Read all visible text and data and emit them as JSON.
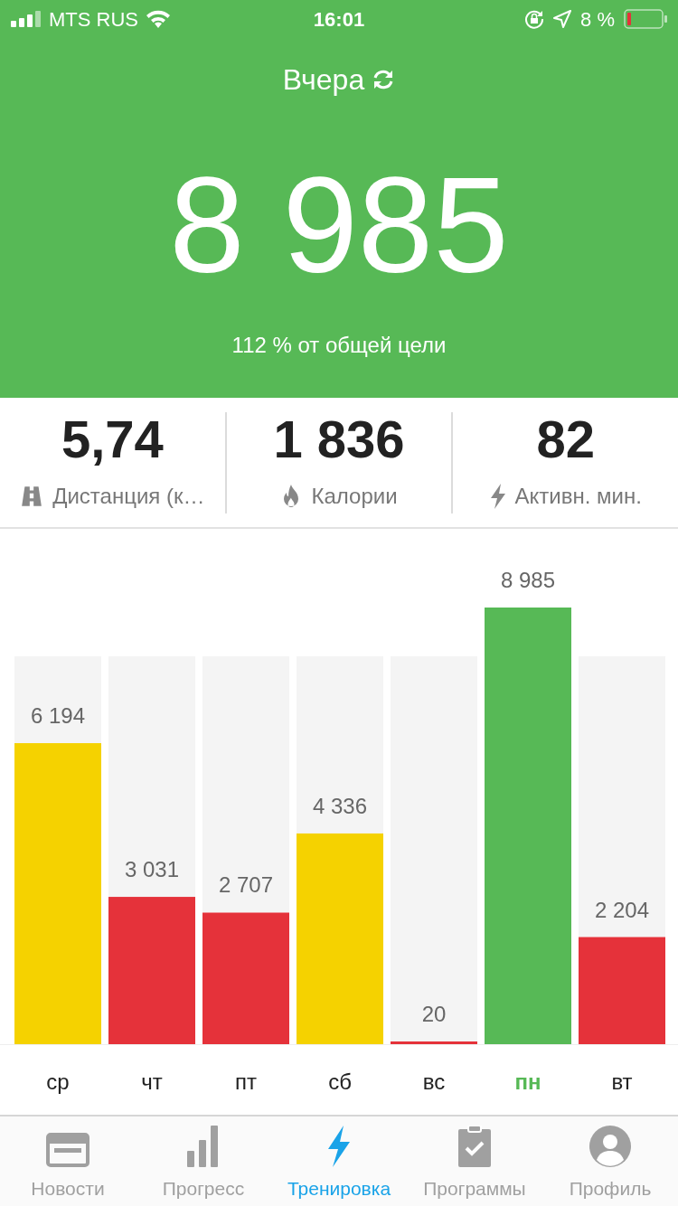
{
  "status_bar": {
    "carrier": "MTS RUS",
    "time": "16:01",
    "battery": "8 %"
  },
  "header": {
    "title": "Вчера",
    "steps": "8 985",
    "goal_text": "112 % от общей цели"
  },
  "stats": [
    {
      "kind": "distance",
      "value": "5,74",
      "label": "Дистанция (к…"
    },
    {
      "kind": "calories",
      "value": "1 836",
      "label": "Калории"
    },
    {
      "kind": "active",
      "value": "82",
      "label": "Активн. мин."
    }
  ],
  "chart": {
    "chart_data": {
      "type": "bar",
      "categories": [
        "ср",
        "чт",
        "пт",
        "сб",
        "вс",
        "пн",
        "вт"
      ],
      "values": [
        6194,
        3031,
        2707,
        4336,
        20,
        8985,
        2204
      ],
      "data_labels": true
    },
    "bars": [
      {
        "color": "#f5d200",
        "selected": false
      },
      {
        "color": "#e5323a",
        "selected": false
      },
      {
        "color": "#e5323a",
        "selected": false
      },
      {
        "color": "#f5d200",
        "selected": false
      },
      {
        "color": "#e5323a",
        "selected": false
      },
      {
        "color": "#57b956",
        "selected": true
      },
      {
        "color": "#e5323a",
        "selected": false
      }
    ]
  },
  "tabs": [
    {
      "kind": "news",
      "label": "Новости",
      "selected": false
    },
    {
      "kind": "progress",
      "label": "Прогресс",
      "selected": false
    },
    {
      "kind": "workout",
      "label": "Тренировка",
      "selected": true
    },
    {
      "kind": "programs",
      "label": "Программы",
      "selected": false
    },
    {
      "kind": "profile",
      "label": "Профиль",
      "selected": false
    }
  ]
}
